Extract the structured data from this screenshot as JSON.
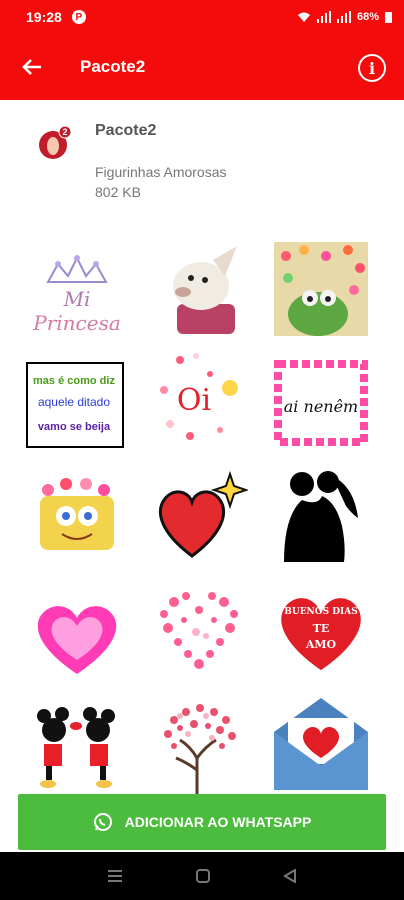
{
  "status_bar": {
    "time": "19:28",
    "app_badge": "P",
    "battery": "68%"
  },
  "app_bar": {
    "title": "Pacote2"
  },
  "pack": {
    "name": "Pacote2",
    "publisher": "Figurinhas Amorosas",
    "size": "802 KB",
    "icon_badge": "2"
  },
  "stickers": [
    {
      "name": "mi-princesa",
      "line1": "Mi",
      "line2": "Princesa"
    },
    {
      "name": "chihuahua-dog"
    },
    {
      "name": "kermit-hearts"
    },
    {
      "name": "dito-text",
      "line1": "mas é como diz",
      "line2": "aquele ditado",
      "line3": "vamo se beija"
    },
    {
      "name": "oi-hearts",
      "text": "Oi"
    },
    {
      "name": "a-nenem",
      "text": "ai nenêm"
    },
    {
      "name": "spongebob-hearts"
    },
    {
      "name": "red-heart-sparkle"
    },
    {
      "name": "couple-silhouette"
    },
    {
      "name": "pink-heart"
    },
    {
      "name": "heart-of-hearts"
    },
    {
      "name": "buenos-dias-te-amo",
      "line1": "BUENOS DIAS",
      "line2": "TE",
      "line3": "AMO"
    },
    {
      "name": "mickey-minnie-kiss"
    },
    {
      "name": "heart-tree"
    },
    {
      "name": "love-envelope"
    }
  ],
  "add_button": {
    "label": "ADICIONAR AO WHATSAPP"
  },
  "colors": {
    "primary": "#f40c0c",
    "whatsapp_green": "#4cbc3e"
  }
}
